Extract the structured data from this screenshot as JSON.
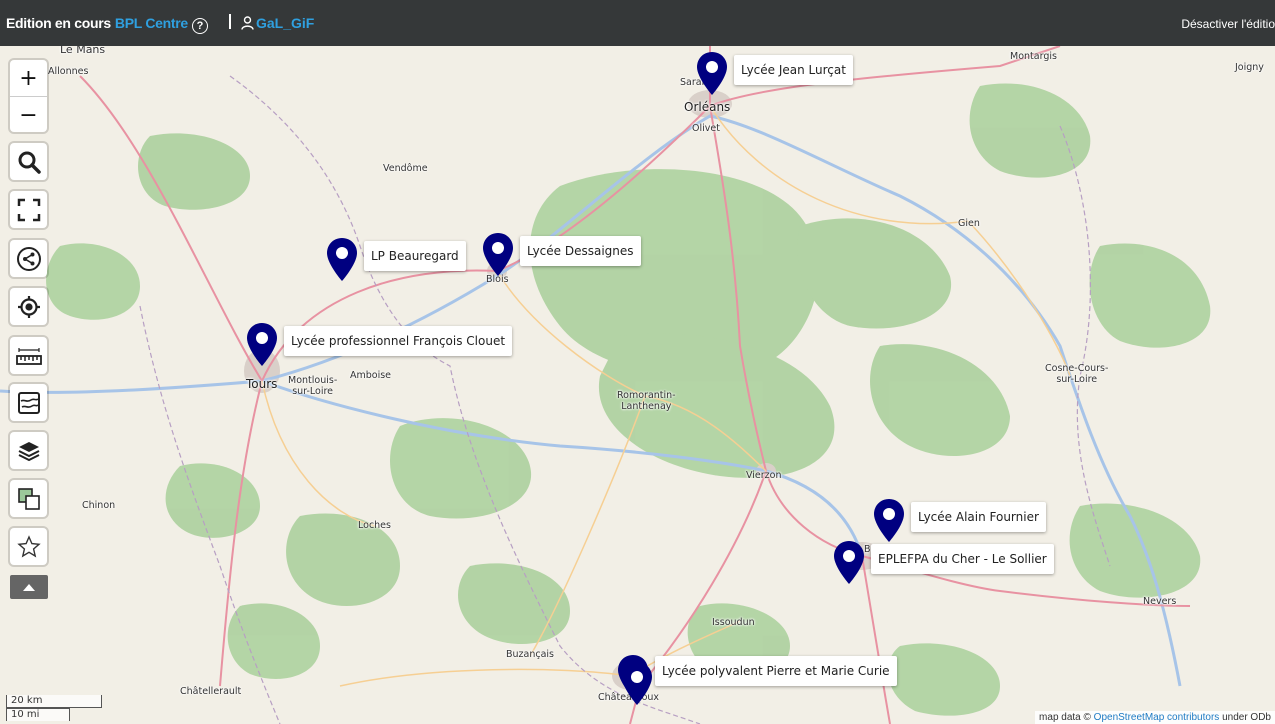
{
  "header": {
    "editing_label": "Edition en cours",
    "map_name": "BPL Centre",
    "help_glyph": "?",
    "username": "GaL_GiF",
    "disable_edit": "Désactiver l'éditio"
  },
  "controls": {
    "zoom_in": "+",
    "zoom_out": "−",
    "icons": [
      "search-icon",
      "fullscreen-icon",
      "share-icon",
      "locate-icon",
      "measure-icon",
      "map-edit-icon",
      "layers-icon",
      "tilelayer-icon",
      "star-icon"
    ]
  },
  "towns": {
    "le_mans": "Le Mans",
    "allonnes": "Allonnes",
    "saran": "Saran",
    "orleans": "Orléans",
    "olivet": "Olivet",
    "montargis": "Montargis",
    "joigny": "Joigny",
    "vendome": "Vendôme",
    "blois": "Blois",
    "gien": "Gien",
    "tours": "Tours",
    "montlouis": "Montlouis-\nsur-Loire",
    "amboise": "Amboise",
    "romorantin": "Romorantin-\nLanthenay",
    "cosne": "Cosne-Cours-\nsur-Loire",
    "vierzon": "Vierzon",
    "chinon": "Chinon",
    "loches": "Loches",
    "bourges": "B",
    "nevers": "Nevers",
    "issoudun": "Issoudun",
    "buzancais": "Buzançais",
    "chatellerault": "Châtellerault",
    "chateauroux": "Châteauroux"
  },
  "markers": [
    {
      "label": "Lycée Jean Lurçat"
    },
    {
      "label": "LP Beauregard"
    },
    {
      "label": "Lycée Dessaignes"
    },
    {
      "label": "Lycée professionnel François Clouet"
    },
    {
      "label": "Lycée Alain Fournier"
    },
    {
      "label": "EPLEFPA du Cher - Le Sollier"
    },
    {
      "label": "Lycée polyvalent Pierre et Marie Curie"
    }
  ],
  "scale": {
    "km": "20 km",
    "mi": "10 mi"
  },
  "attribution": {
    "prefix": "map data ©",
    "link": "OpenStreetMap contributors",
    "suffix": "under ODb"
  },
  "colors": {
    "topbar": "#353839",
    "accent": "#2fa0e0",
    "marker": "#000080",
    "forest": "#add19e",
    "road": "#e892a2"
  }
}
